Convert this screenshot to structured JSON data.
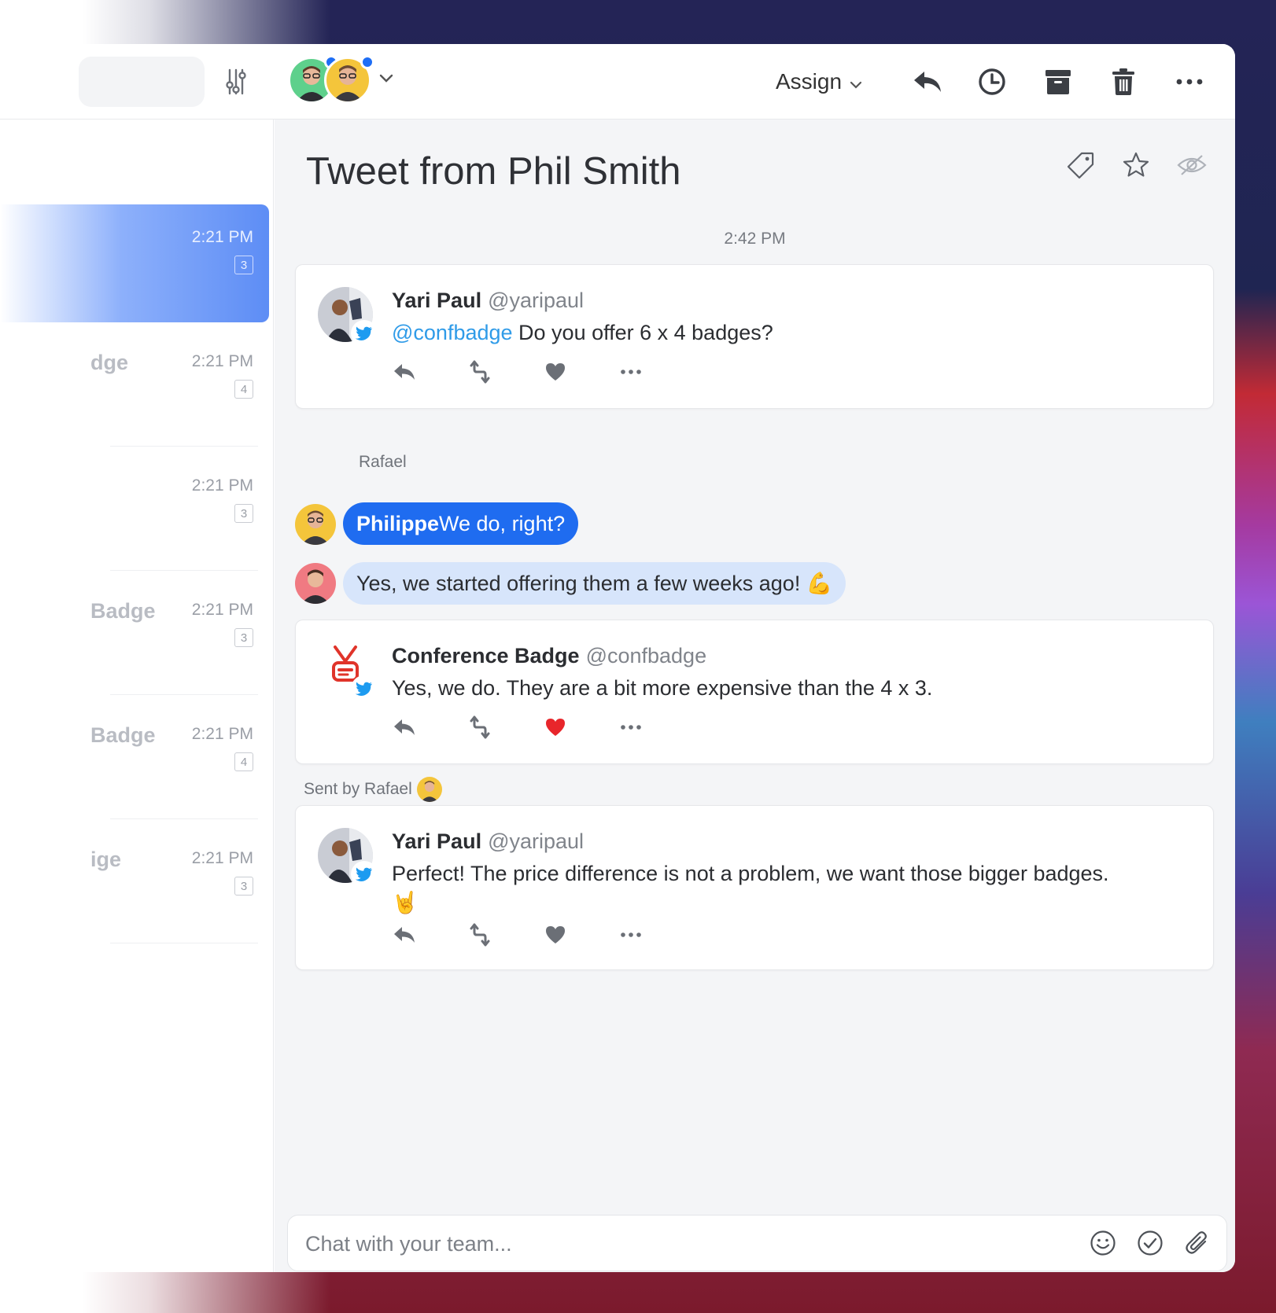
{
  "topbar": {
    "assign_label": "Assign",
    "assignees": [
      {
        "name": "assignee-1",
        "color": "#5ed08c"
      },
      {
        "name": "assignee-2",
        "color": "#f4c53b"
      }
    ],
    "actions": [
      "reply-icon",
      "clock-icon",
      "archive-icon",
      "trash-icon",
      "more-icon"
    ]
  },
  "list": {
    "items": [
      {
        "subject": "",
        "time": "2:21 PM",
        "count": "3",
        "active": true
      },
      {
        "subject": "dge",
        "time": "2:21 PM",
        "count": "4",
        "active": false
      },
      {
        "subject": "",
        "time": "2:21 PM",
        "count": "3",
        "active": false
      },
      {
        "subject": "Badge",
        "time": "2:21 PM",
        "count": "3",
        "active": false
      },
      {
        "subject": "Badge",
        "time": "2:21 PM",
        "count": "4",
        "active": false
      },
      {
        "subject": "ige",
        "time": "2:21 PM",
        "count": "3",
        "active": false
      }
    ]
  },
  "conversation": {
    "title": "Tweet from Phil Smith",
    "timestamp": "2:42 PM",
    "tweet1": {
      "name": "Yari Paul",
      "handle": "@yaripaul",
      "mention": "@confbadge",
      "text": " Do you offer 6 x 4 badges?"
    },
    "chat": {
      "sender_label": "Rafael",
      "msg1_mention": "Philippe",
      "msg1_text": " We do, right?",
      "msg2_text": "Yes, we started offering them a few weeks ago! 💪"
    },
    "tweet2": {
      "name": "Conference Badge",
      "handle": "@confbadge",
      "text": "Yes, we do. They are a bit more expensive than the 4 x 3.",
      "liked": true
    },
    "sent_by": "Sent by Rafael",
    "tweet3": {
      "name": "Yari Paul",
      "handle": "@yaripaul",
      "text": "Perfect! The price difference is not a problem, we want those bigger badges.",
      "emoji": "🤘"
    }
  },
  "composer": {
    "placeholder": "Chat with your team..."
  },
  "colors": {
    "accent": "#1f6cf0",
    "mention": "#2f9be8",
    "liked": "#e8262b",
    "bubble_light": "#d7e5fb"
  }
}
